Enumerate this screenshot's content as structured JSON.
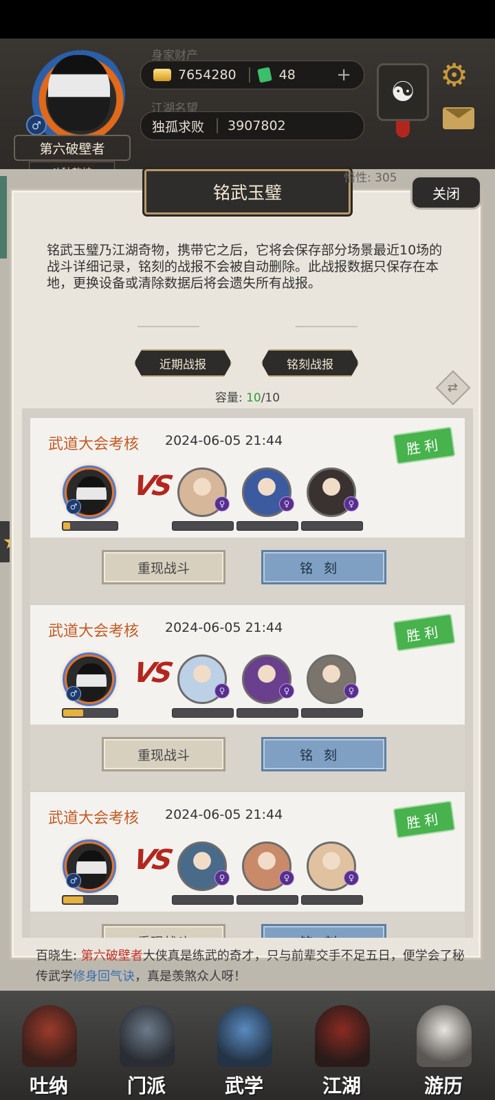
{
  "header": {
    "wealth_label": "身家财产",
    "gold": "7654280",
    "jade": "48",
    "fame_label": "江湖名望",
    "fame_title": "独孤求败",
    "fame_value": "3907802",
    "player_name": "第六破壁者",
    "player_rank": "斗破乾坤",
    "stat_peek": "悟性: 305"
  },
  "dialog": {
    "title": "铭武玉璧",
    "close_label": "关闭",
    "description": "铭武玉璧乃江湖奇物，携带它之后，它将会保存部分场景最近10场的战斗详细记录，铭刻的战报不会被自动删除。此战报数据只保存在本地，更换设备或清除数据后将会遗失所有战报。",
    "tabs": [
      "近期战报",
      "铭刻战报"
    ],
    "capacity_label": "容量:",
    "capacity_current": "10",
    "capacity_total": "/10"
  },
  "battles": [
    {
      "name": "武道大会考核",
      "time": "2024-06-05 21:44",
      "result": "胜利",
      "player_hp": 0.12,
      "replay_label": "重现战斗",
      "engrave_label": "铭刻",
      "opponent_colors": [
        "#d7b79a",
        "#3b5aa0",
        "#3a3230"
      ]
    },
    {
      "name": "武道大会考核",
      "time": "2024-06-05 21:44",
      "result": "胜利",
      "player_hp": 0.36,
      "replay_label": "重现战斗",
      "engrave_label": "铭刻",
      "opponent_colors": [
        "#bcd1e6",
        "#6a3f8e",
        "#7a746c"
      ]
    },
    {
      "name": "武道大会考核",
      "time": "2024-06-05 21:44",
      "result": "胜利",
      "player_hp": 0.36,
      "replay_label": "重现战斗",
      "engrave_label": "铭刻",
      "opponent_colors": [
        "#4a6a8a",
        "#c98a6a",
        "#e0c2a0"
      ]
    }
  ],
  "notice": {
    "prefix": "百晓生: ",
    "name": "第六破壁者",
    "middle": "大侠真是练武的奇才，只与前辈交手不足五日，便学会了秘传武学",
    "skill": "修身回气诀",
    "suffix": "，真是羡煞众人呀！"
  },
  "nav": [
    {
      "label": "吐纳",
      "icon": "gourd-icon"
    },
    {
      "label": "门派",
      "icon": "clan-icon"
    },
    {
      "label": "武学",
      "icon": "scroll-icon"
    },
    {
      "label": "江湖",
      "icon": "hat-icon"
    },
    {
      "label": "游历",
      "icon": "horse-icon"
    }
  ],
  "colors": {
    "accent_orange": "#c45a24",
    "win_green": "#48b24d",
    "engrave_blue": "#7fa0c2",
    "capacity_green": "#2e9a3a"
  }
}
